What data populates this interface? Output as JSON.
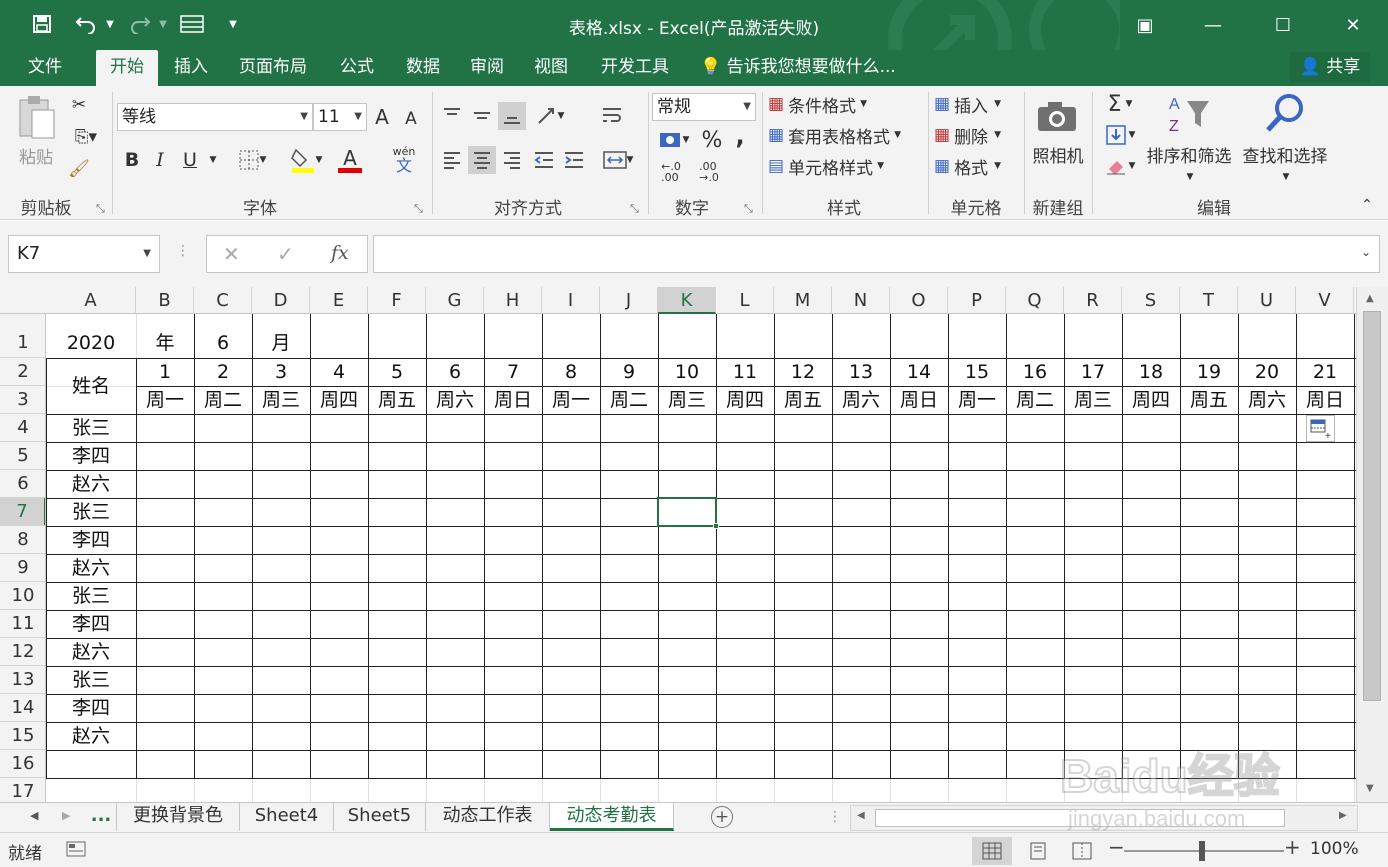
{
  "title_bar": {
    "title": "表格.xlsx - Excel(产品激活失败)",
    "save_icon": "save-icon",
    "undo_icon": "undo-icon",
    "redo_icon": "redo-icon"
  },
  "window_controls": {
    "restore_ribbon": "▣",
    "minimize": "—",
    "maximize": "☐",
    "close": "✕"
  },
  "tabs": [
    {
      "label": "文件"
    },
    {
      "label": "开始"
    },
    {
      "label": "插入"
    },
    {
      "label": "页面布局"
    },
    {
      "label": "公式"
    },
    {
      "label": "数据"
    },
    {
      "label": "审阅"
    },
    {
      "label": "视图"
    },
    {
      "label": "开发工具"
    }
  ],
  "tell_me": "告诉我您想要做什么...",
  "share": "共享",
  "ribbon": {
    "clipboard": {
      "paste": "粘贴",
      "label": "剪贴板"
    },
    "font": {
      "name": "等线",
      "size": "11",
      "bold": "B",
      "italic": "I",
      "underline": "U",
      "grow": "A",
      "shrink": "A",
      "phonetic": "wén",
      "phonetic_char": "文",
      "color_letter": "A",
      "label": "字体"
    },
    "alignment": {
      "label": "对齐方式"
    },
    "number": {
      "format": "常规",
      "percent": "%",
      "comma": ",",
      "inc_decimal": "←.0\n.00",
      "dec_decimal": ".00\n→.0",
      "label": "数字"
    },
    "styles": {
      "conditional": "条件格式",
      "table": "套用表格格式",
      "cell": "单元格样式",
      "label": "样式"
    },
    "cells": {
      "insert": "插入",
      "delete": "删除",
      "format": "格式",
      "label": "单元格"
    },
    "camera": {
      "camera": "照相机",
      "label": "新建组"
    },
    "editing": {
      "sum": "Σ",
      "sort": "排序和筛选",
      "find": "查找和选择",
      "label": "编辑"
    }
  },
  "formula_bar": {
    "name_box": "K7",
    "cancel": "✕",
    "enter": "✓",
    "fx": "fx",
    "formula": ""
  },
  "grid": {
    "columns": [
      "A",
      "B",
      "C",
      "D",
      "E",
      "F",
      "G",
      "H",
      "I",
      "J",
      "K",
      "L",
      "M",
      "N",
      "O",
      "P",
      "Q",
      "R",
      "S",
      "T",
      "U",
      "V"
    ],
    "selected_column": "K",
    "rows": [
      "1",
      "2",
      "3",
      "4",
      "5",
      "6",
      "7",
      "8",
      "9",
      "10",
      "11",
      "12",
      "13",
      "14",
      "15",
      "16",
      "17"
    ],
    "selected_row": "7",
    "row1": {
      "year": "2020",
      "year_unit": "年",
      "month": "6",
      "month_unit": "月"
    },
    "name_header": "姓名",
    "days": [
      "1",
      "2",
      "3",
      "4",
      "5",
      "6",
      "7",
      "8",
      "9",
      "10",
      "11",
      "12",
      "13",
      "14",
      "15",
      "16",
      "17",
      "18",
      "19",
      "20",
      "21"
    ],
    "weekdays": [
      "周一",
      "周二",
      "周三",
      "周四",
      "周五",
      "周六",
      "周日",
      "周一",
      "周二",
      "周三",
      "周四",
      "周五",
      "周六",
      "周日",
      "周一",
      "周二",
      "周三",
      "周四",
      "周五",
      "周六",
      "周日"
    ],
    "names": [
      "张三",
      "李四",
      "赵六",
      "张三",
      "李四",
      "赵六",
      "张三",
      "李四",
      "赵六",
      "张三",
      "李四",
      "赵六"
    ]
  },
  "sheets": {
    "more": "...",
    "tabs": [
      {
        "label": "更换背景色"
      },
      {
        "label": "Sheet4"
      },
      {
        "label": "Sheet5"
      },
      {
        "label": "动态工作表"
      },
      {
        "label": "动态考勤表"
      }
    ],
    "active": "动态考勤表",
    "add": "+"
  },
  "status_bar": {
    "status": "就绪",
    "zoom": "100%",
    "zoom_minus": "−",
    "zoom_plus": "+"
  },
  "watermark": {
    "text": "Baidu经验",
    "url": "jingyan.baidu.com"
  },
  "colors": {
    "accent": "#217346",
    "ribbon_bg": "#f3f3f3",
    "font_color_red": "#e00000",
    "fill_yellow": "#ffff00"
  }
}
